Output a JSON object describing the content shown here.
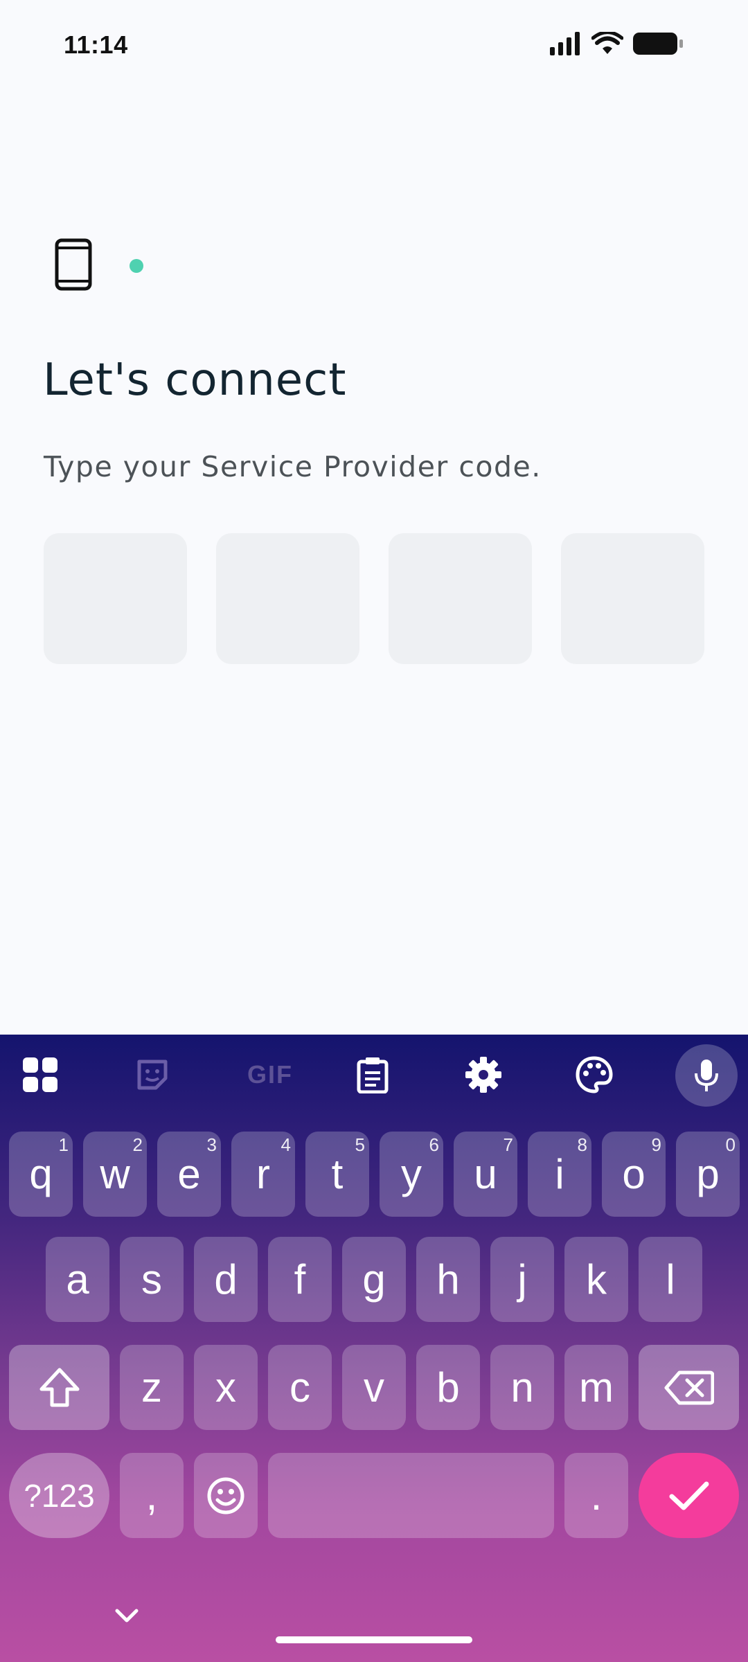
{
  "status": {
    "time": "11:14"
  },
  "screen": {
    "title": "Let's connect",
    "subtitle": "Type your Service Provider code.",
    "code_boxes": [
      "",
      "",
      "",
      ""
    ],
    "accent_dot_color": "#4fd1b0"
  },
  "keyboard": {
    "toolbar": [
      {
        "icon": "apps-grid-icon"
      },
      {
        "icon": "sticker-icon"
      },
      {
        "label": "GIF",
        "icon": "gif-icon"
      },
      {
        "icon": "clipboard-icon"
      },
      {
        "icon": "gear-icon"
      },
      {
        "icon": "palette-icon"
      },
      {
        "icon": "mic-icon"
      }
    ],
    "row1": [
      {
        "k": "q",
        "h": "1"
      },
      {
        "k": "w",
        "h": "2"
      },
      {
        "k": "e",
        "h": "3"
      },
      {
        "k": "r",
        "h": "4"
      },
      {
        "k": "t",
        "h": "5"
      },
      {
        "k": "y",
        "h": "6"
      },
      {
        "k": "u",
        "h": "7"
      },
      {
        "k": "i",
        "h": "8"
      },
      {
        "k": "o",
        "h": "9"
      },
      {
        "k": "p",
        "h": "0"
      }
    ],
    "row2": [
      "a",
      "s",
      "d",
      "f",
      "g",
      "h",
      "j",
      "k",
      "l"
    ],
    "row3": [
      "z",
      "x",
      "c",
      "v",
      "b",
      "n",
      "m"
    ],
    "symbols_label": "?123",
    "comma_label": ",",
    "period_label": ".",
    "enter_color": "#f43c9c"
  }
}
